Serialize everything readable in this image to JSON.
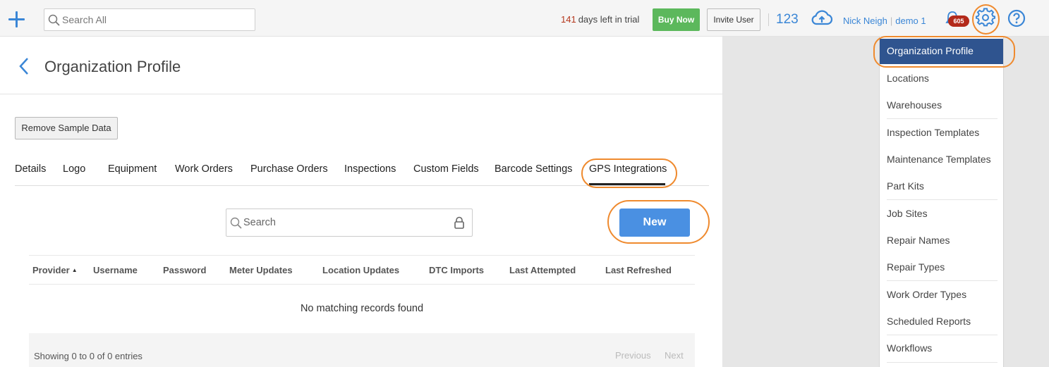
{
  "topbar": {
    "search_placeholder": "Search All",
    "trial_days": "141",
    "trial_text": "days left in trial",
    "buy_now": "Buy Now",
    "invite_user": "Invite User",
    "count": "123",
    "user_name": "Nick Neigh",
    "company": "demo 1",
    "notification_count": "605"
  },
  "page": {
    "title": "Organization Profile",
    "remove_sample": "Remove Sample Data"
  },
  "tabs": [
    {
      "label": "Details"
    },
    {
      "label": "Logo"
    },
    {
      "label": "Equipment"
    },
    {
      "label": "Work Orders"
    },
    {
      "label": "Purchase Orders"
    },
    {
      "label": "Inspections"
    },
    {
      "label": "Custom Fields"
    },
    {
      "label": "Barcode Settings"
    },
    {
      "label": "GPS Integrations",
      "active": true
    }
  ],
  "table": {
    "search_placeholder": "Search",
    "new_button": "New",
    "columns": [
      "Provider",
      "Username",
      "Password",
      "Meter Updates",
      "Location Updates",
      "DTC Imports",
      "Last Attempted",
      "Last Refreshed"
    ],
    "sorted_column": "Provider",
    "empty_message": "No matching records found",
    "showing": "Showing 0 to 0 of 0 entries",
    "previous": "Previous",
    "next": "Next"
  },
  "settings_menu": {
    "items": [
      {
        "label": "Organization Profile",
        "active": true
      },
      {
        "label": "Locations"
      },
      {
        "label": "Warehouses"
      },
      {
        "label": "Inspection Templates"
      },
      {
        "label": "Maintenance Templates"
      },
      {
        "label": "Part Kits"
      },
      {
        "label": "Job Sites"
      },
      {
        "label": "Repair Names"
      },
      {
        "label": "Repair Types"
      },
      {
        "label": "Work Order Types"
      },
      {
        "label": "Scheduled Reports"
      },
      {
        "label": "Workflows"
      }
    ]
  },
  "colors": {
    "accent": "#3a86d6",
    "buy_now": "#5cb85c",
    "new_button": "#4a90e2",
    "menu_active": "#2f548f",
    "highlight_ring": "#ef8a2e",
    "badge": "#b32a1a"
  },
  "icons": [
    "plus-icon",
    "search-icon",
    "upload-cloud-icon",
    "bell-icon",
    "gear-icon",
    "help-icon",
    "back-chevron-icon",
    "lock-icon",
    "sort-asc-icon"
  ]
}
